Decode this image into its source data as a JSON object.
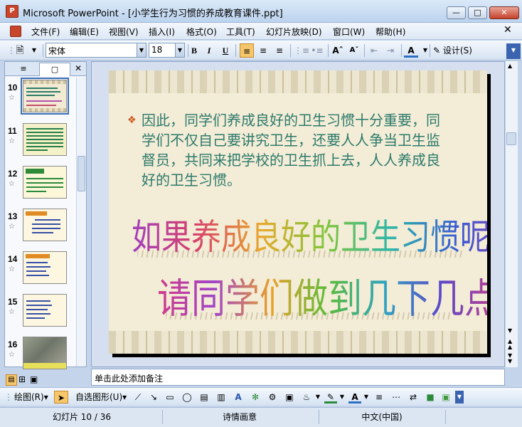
{
  "window": {
    "title": "Microsoft PowerPoint - [小学生行为习惯的养成教育课件.ppt]",
    "icon": "P"
  },
  "menu": [
    "文件(F)",
    "编辑(E)",
    "视图(V)",
    "插入(I)",
    "格式(O)",
    "工具(T)",
    "幻灯片放映(D)",
    "窗口(W)",
    "帮助(H)"
  ],
  "toolbar": {
    "font": "宋体",
    "size": "18",
    "bold": "B",
    "italic": "I",
    "underline": "U",
    "design": "设计(S)"
  },
  "slides": [
    {
      "num": "10"
    },
    {
      "num": "11"
    },
    {
      "num": "12"
    },
    {
      "num": "13"
    },
    {
      "num": "14"
    },
    {
      "num": "15"
    },
    {
      "num": "16"
    }
  ],
  "slide": {
    "body": "因此，同学们养成良好的卫生习惯十分重要，同学们不仅自己要讲究卫生，还要人人争当卫生监督员，共同来把学校的卫生抓上去，人人养成良好的卫生习惯。",
    "wordart1": "如果养成良好的卫生习惯呢？",
    "wordart2": "请同学们做到几下几点"
  },
  "notes": {
    "placeholder": "单击此处添加备注"
  },
  "draw": {
    "draw_label": "绘图(R)",
    "autoshape_label": "自选图形(U)"
  },
  "status": {
    "slide": "幻灯片 10 / 36",
    "design": "诗情画意",
    "language": "中文(中国)"
  }
}
